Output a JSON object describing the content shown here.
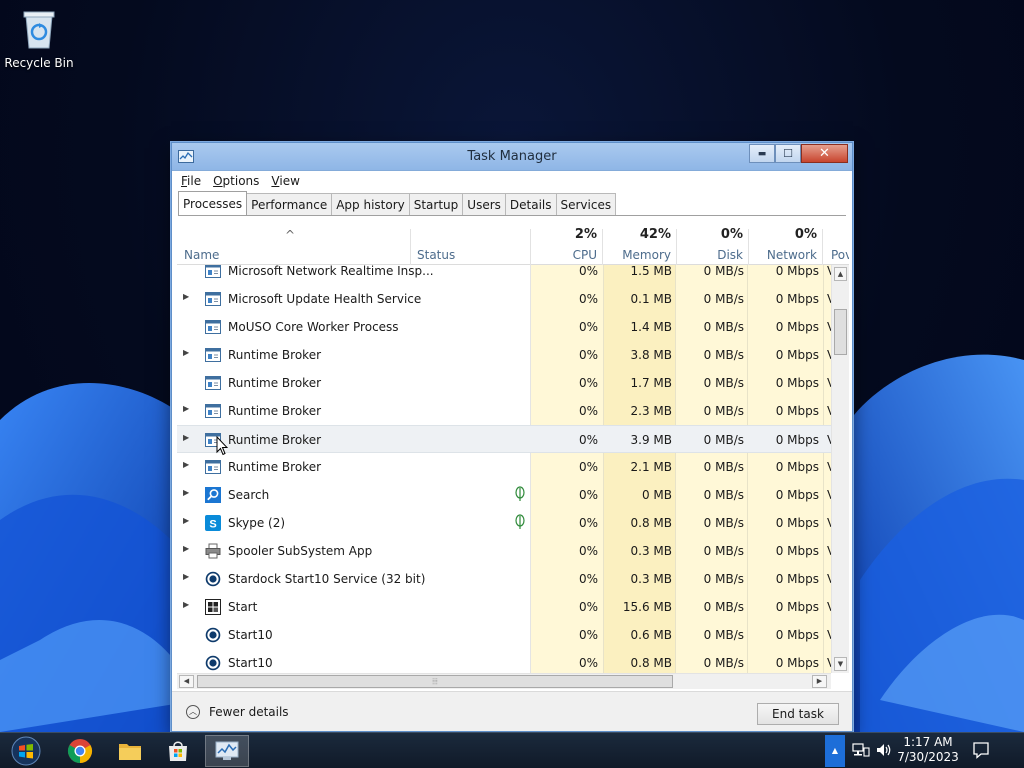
{
  "desktop": {
    "recycle_bin_label": "Recycle Bin"
  },
  "window": {
    "title": "Task Manager",
    "controls": {
      "minimize": "▬",
      "maximize": "☐",
      "close": "✕"
    }
  },
  "menu": [
    {
      "underline": "F",
      "rest": "ile"
    },
    {
      "underline": "O",
      "rest": "ptions"
    },
    {
      "underline": "V",
      "rest": "iew"
    }
  ],
  "tabs": [
    "Processes",
    "Performance",
    "App history",
    "Startup",
    "Users",
    "Details",
    "Services"
  ],
  "active_tab": "Processes",
  "columns": {
    "name": "Name",
    "status": "Status",
    "cpu": {
      "label": "CPU",
      "pct": "2%"
    },
    "memory": {
      "label": "Memory",
      "pct": "42%"
    },
    "disk": {
      "label": "Disk",
      "pct": "0%"
    },
    "network": {
      "label": "Network",
      "pct": "0%"
    },
    "power": {
      "label": "Pov"
    }
  },
  "processes": [
    {
      "name": "Microsoft Network Realtime Insp...",
      "expandable": false,
      "icon": "service-icon",
      "status": "",
      "cpu": "0%",
      "memory": "1.5 MB",
      "disk": "0 MB/s",
      "network": "0 Mbps",
      "power": "V"
    },
    {
      "name": "Microsoft Update Health Service",
      "expandable": true,
      "icon": "service-icon",
      "status": "",
      "cpu": "0%",
      "memory": "0.1 MB",
      "disk": "0 MB/s",
      "network": "0 Mbps",
      "power": "V"
    },
    {
      "name": "MoUSO Core Worker Process",
      "expandable": false,
      "icon": "service-icon",
      "status": "",
      "cpu": "0%",
      "memory": "1.4 MB",
      "disk": "0 MB/s",
      "network": "0 Mbps",
      "power": "V"
    },
    {
      "name": "Runtime Broker",
      "expandable": true,
      "icon": "service-icon",
      "status": "",
      "cpu": "0%",
      "memory": "3.8 MB",
      "disk": "0 MB/s",
      "network": "0 Mbps",
      "power": "V"
    },
    {
      "name": "Runtime Broker",
      "expandable": false,
      "icon": "service-icon",
      "status": "",
      "cpu": "0%",
      "memory": "1.7 MB",
      "disk": "0 MB/s",
      "network": "0 Mbps",
      "power": "V"
    },
    {
      "name": "Runtime Broker",
      "expandable": true,
      "icon": "service-icon",
      "status": "",
      "cpu": "0%",
      "memory": "2.3 MB",
      "disk": "0 MB/s",
      "network": "0 Mbps",
      "power": "V"
    },
    {
      "name": "Runtime Broker",
      "expandable": true,
      "icon": "service-icon",
      "status": "",
      "cpu": "0%",
      "memory": "3.9 MB",
      "disk": "0 MB/s",
      "network": "0 Mbps",
      "power": "V",
      "hover": true
    },
    {
      "name": "Runtime Broker",
      "expandable": true,
      "icon": "service-icon",
      "status": "",
      "cpu": "0%",
      "memory": "2.1 MB",
      "disk": "0 MB/s",
      "network": "0 Mbps",
      "power": "V"
    },
    {
      "name": "Search",
      "expandable": true,
      "icon": "search-icon",
      "status": "suspended-leaf-icon",
      "cpu": "0%",
      "memory": "0 MB",
      "disk": "0 MB/s",
      "network": "0 Mbps",
      "power": "V"
    },
    {
      "name": "Skype (2)",
      "expandable": true,
      "icon": "skype-icon",
      "status": "suspended-leaf-icon",
      "cpu": "0%",
      "memory": "0.8 MB",
      "disk": "0 MB/s",
      "network": "0 Mbps",
      "power": "V"
    },
    {
      "name": "Spooler SubSystem App",
      "expandable": true,
      "icon": "printer-icon",
      "status": "",
      "cpu": "0%",
      "memory": "0.3 MB",
      "disk": "0 MB/s",
      "network": "0 Mbps",
      "power": "V"
    },
    {
      "name": "Stardock Start10 Service (32 bit)",
      "expandable": true,
      "icon": "start10-icon",
      "status": "",
      "cpu": "0%",
      "memory": "0.3 MB",
      "disk": "0 MB/s",
      "network": "0 Mbps",
      "power": "V"
    },
    {
      "name": "Start",
      "expandable": true,
      "icon": "start-app-icon",
      "status": "",
      "cpu": "0%",
      "memory": "15.6 MB",
      "disk": "0 MB/s",
      "network": "0 Mbps",
      "power": "V"
    },
    {
      "name": "Start10",
      "expandable": false,
      "icon": "start10-icon",
      "status": "",
      "cpu": "0%",
      "memory": "0.6 MB",
      "disk": "0 MB/s",
      "network": "0 Mbps",
      "power": "V"
    },
    {
      "name": "Start10",
      "expandable": false,
      "icon": "start10-icon",
      "status": "",
      "cpu": "0%",
      "memory": "0.8 MB",
      "disk": "0 MB/s",
      "network": "0 Mbps",
      "power": "V"
    }
  ],
  "footer": {
    "fewer_details": "Fewer details",
    "end_task": "End task"
  },
  "taskbar": {
    "apps": [
      "windows-start-icon",
      "chrome-icon",
      "file-explorer-icon",
      "store-icon",
      "task-manager-icon"
    ],
    "time": "1:17 AM",
    "date": "7/30/2023"
  },
  "colors": {
    "cpu_column_bg": "#fff8d7",
    "memory_column_bg": "#fbf0c0",
    "title_bar": "#9fc0ea",
    "tray_highlight": "#1d6ed8"
  }
}
